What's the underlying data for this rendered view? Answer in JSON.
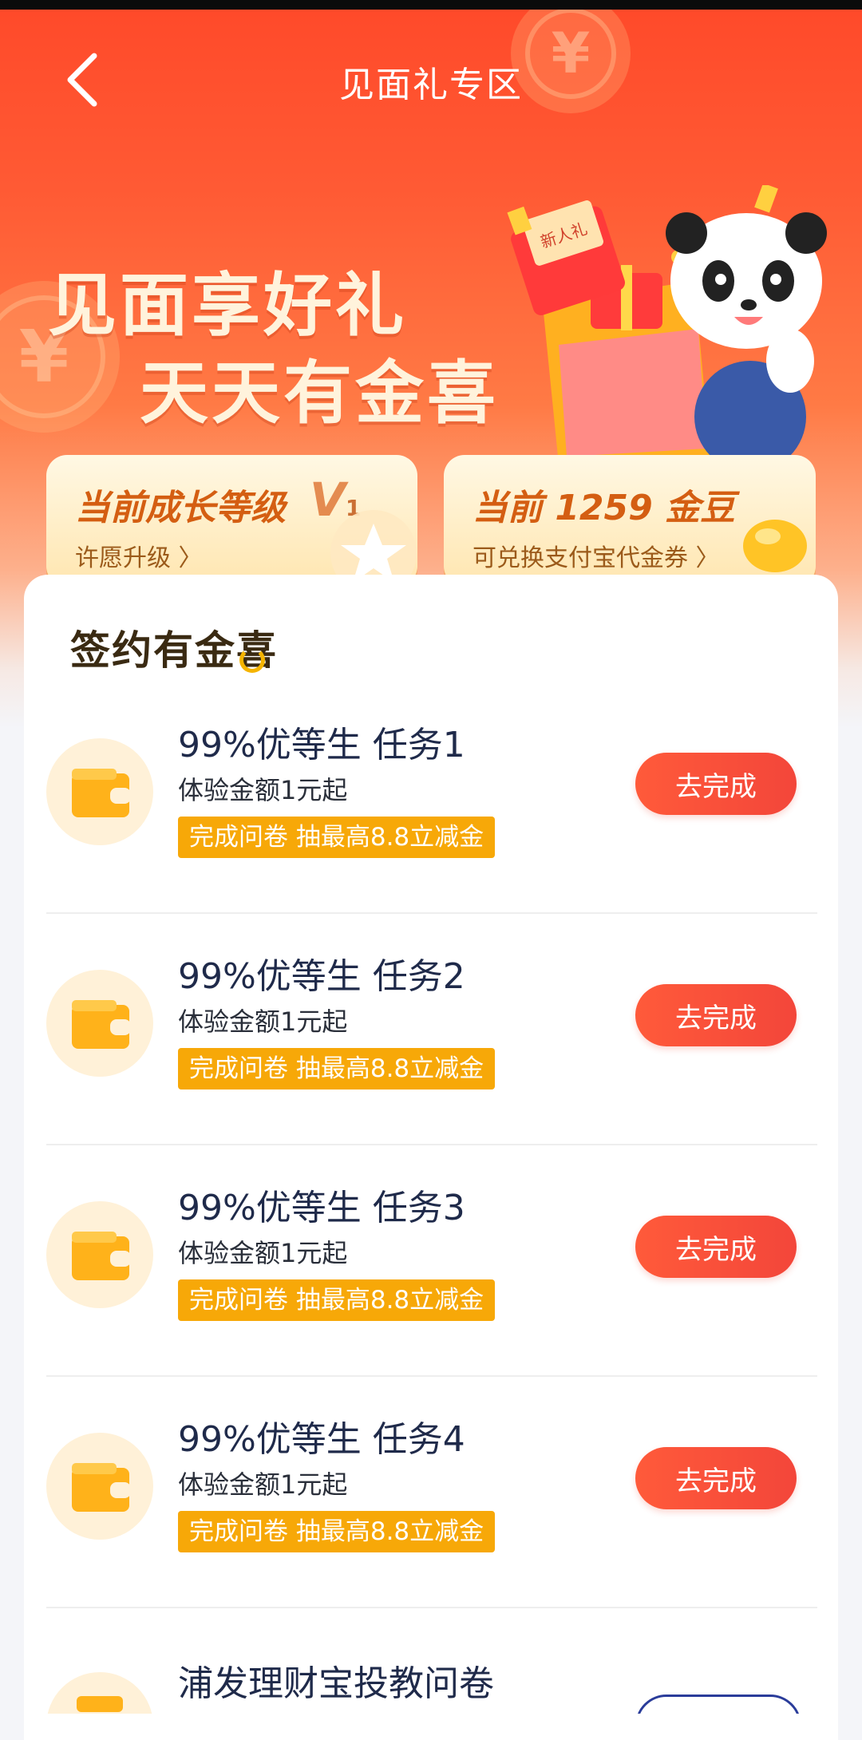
{
  "header": {
    "title": "见面礼专区"
  },
  "banner": {
    "line1": "见面享好礼",
    "line2": "天天有金喜",
    "gift_card_text": "新人礼"
  },
  "growth_card": {
    "title": "当前成长等级",
    "level_letter": "V",
    "level_number": "1",
    "link": "许愿升级 〉"
  },
  "beans_card": {
    "title": "当前  1259  金豆",
    "link": "可兑换支付宝代金券 〉"
  },
  "section": {
    "title": "签约有金喜"
  },
  "tasks": [
    {
      "title": "99%优等生 任务1",
      "subtitle": "体验金额1元起",
      "tag": "完成问卷 抽最高8.8立减金",
      "button": "去完成"
    },
    {
      "title": "99%优等生 任务2",
      "subtitle": "体验金额1元起",
      "tag": "完成问卷 抽最高8.8立减金",
      "button": "去完成"
    },
    {
      "title": "99%优等生 任务3",
      "subtitle": "体验金额1元起",
      "tag": "完成问卷 抽最高8.8立减金",
      "button": "去完成"
    },
    {
      "title": "99%优等生 任务4",
      "subtitle": "体验金额1元起",
      "tag": "完成问卷 抽最高8.8立减金",
      "button": "去完成"
    },
    {
      "title": "浦发理财宝投教问卷",
      "subtitle": "",
      "tag": "",
      "button": ""
    }
  ],
  "colors": {
    "accent": "#f3463a",
    "tag_bg": "#f7a808",
    "hero_top": "#ff4a2a"
  }
}
